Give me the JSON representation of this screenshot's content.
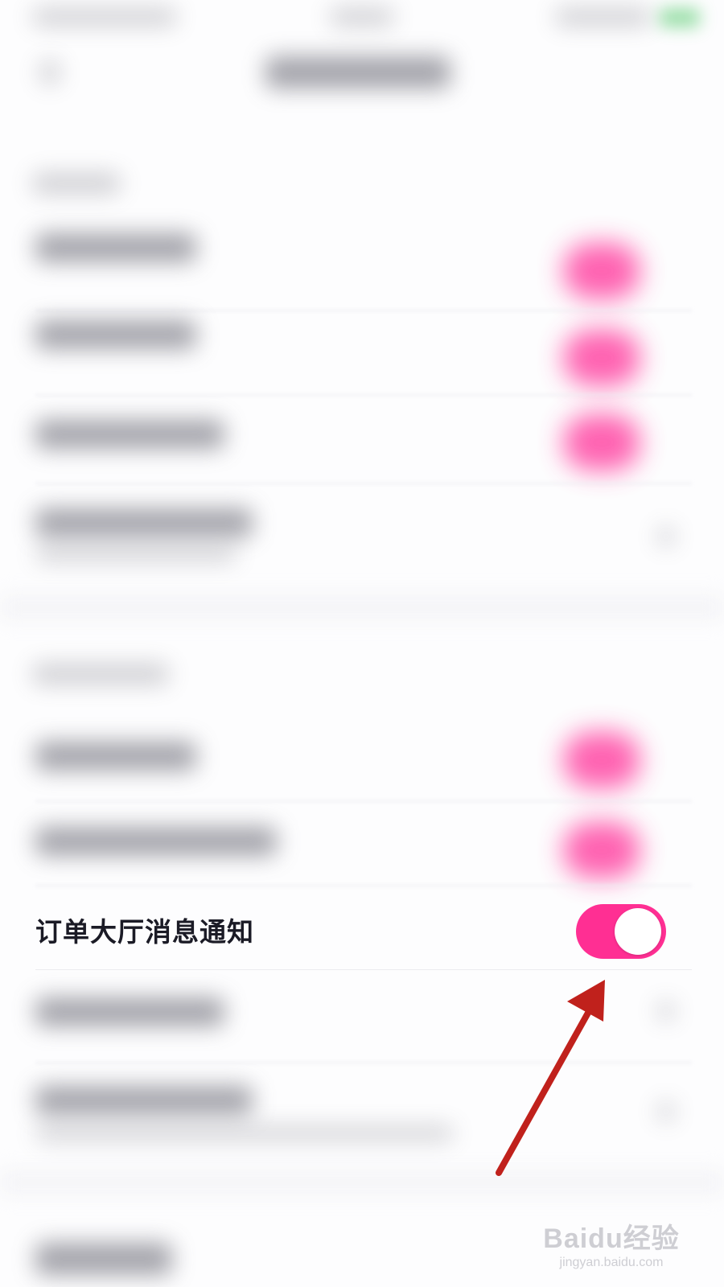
{
  "settings": {
    "order_hall_notification": {
      "label": "订单大厅消息通知",
      "enabled": true
    }
  },
  "colors": {
    "toggle_on": "#ff2f93",
    "annotation_arrow": "#c0211c",
    "label_text": "#1b1b26"
  },
  "watermark": {
    "logo": "Baidu经验",
    "url": "jingyan.baidu.com"
  }
}
